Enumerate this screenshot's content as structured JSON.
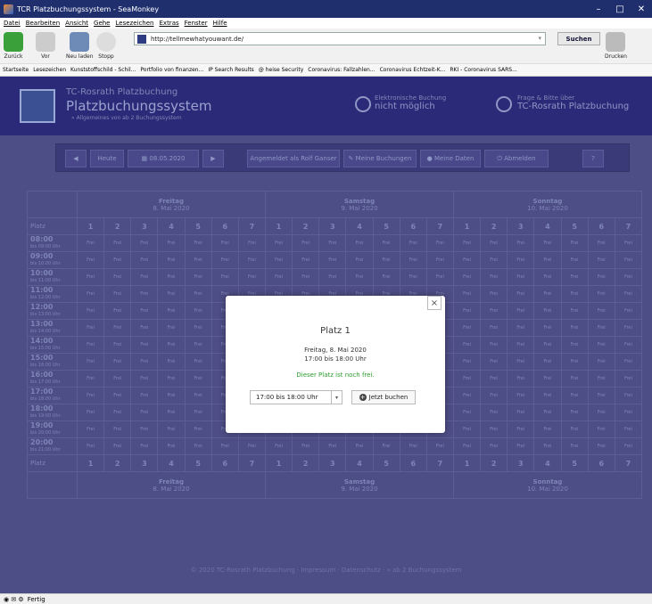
{
  "window": {
    "title": "TCR Platzbuchungssystem - SeaMonkey"
  },
  "menu": [
    "Datei",
    "Bearbeiten",
    "Ansicht",
    "Gehe",
    "Lesezeichen",
    "Extras",
    "Fenster",
    "Hilfe"
  ],
  "nav": {
    "back": "Zurück",
    "forward": "Vor",
    "reload": "Neu laden",
    "stop": "Stopp",
    "url": "http://tellmewhatyouwant.de/",
    "search": "Suchen",
    "print": "Drucken"
  },
  "bookmarks": [
    "Startseite",
    "Lesezeichen",
    "Kunststoffschild - Schil...",
    "Portfolio von finanzen...",
    "IP Search Results",
    "@ heise Security",
    "Coronavirus: Fallzahlen...",
    "Coronavirus Echtzeit-K...",
    "RKI - Coronavirus SARS..."
  ],
  "header": {
    "small": "TC-Rosrath Platzbuchung",
    "title": "Platzbuchungssystem",
    "sub": "»  Allgemeines von ab 2 Buchungssystem",
    "info1_small": "Elektronische Buchung",
    "info1_big": "nicht möglich",
    "info2_small": "Frage & Bitte über",
    "info2_big": "TC-Rosrath Platzbuchung"
  },
  "toolbar": {
    "today": "Heute",
    "date": "08.05.2020",
    "logged": "Angemeldet als Rolf Ganser",
    "my_bookings": "Meine Buchungen",
    "my_data": "Meine Daten",
    "logout": "Abmelden",
    "help": "?"
  },
  "days": [
    {
      "name": "Freitag",
      "date": "8. Mai 2020"
    },
    {
      "name": "Samstag",
      "date": "9. Mai 2020"
    },
    {
      "name": "Sonntag",
      "date": "10. Mai 2020"
    }
  ],
  "platz_label": "Platz",
  "courts": [
    "1",
    "2",
    "3",
    "4",
    "5",
    "6",
    "7"
  ],
  "cell": "Frei",
  "times": [
    {
      "t": "08:00",
      "b": "bis 09:00 Uhr"
    },
    {
      "t": "09:00",
      "b": "bis 10:00 Uhr"
    },
    {
      "t": "10:00",
      "b": "bis 11:00 Uhr"
    },
    {
      "t": "11:00",
      "b": "bis 12:00 Uhr"
    },
    {
      "t": "12:00",
      "b": "bis 13:00 Uhr"
    },
    {
      "t": "13:00",
      "b": "bis 14:00 Uhr"
    },
    {
      "t": "14:00",
      "b": "bis 15:00 Uhr"
    },
    {
      "t": "15:00",
      "b": "bis 16:00 Uhr"
    },
    {
      "t": "16:00",
      "b": "bis 17:00 Uhr"
    },
    {
      "t": "17:00",
      "b": "bis 18:00 Uhr"
    },
    {
      "t": "18:00",
      "b": "bis 19:00 Uhr"
    },
    {
      "t": "19:00",
      "b": "bis 20:00 Uhr"
    },
    {
      "t": "20:00",
      "b": "bis 21:00 Uhr"
    }
  ],
  "footer": "© 2020 TC-Rosrath Platzbuchung · Impressum · Datenschutz · » ab 2 Buchungssystem",
  "modal": {
    "title": "Platz 1",
    "date": "Freitag, 8. Mai 2020",
    "time": "17:00 bis 18:00 Uhr",
    "status": "Dieser Platz ist noch frei.",
    "select": "17:00 bis 18:00 Uhr",
    "book": "Jetzt buchen",
    "close": "×"
  },
  "status": {
    "text": "Fertig"
  }
}
